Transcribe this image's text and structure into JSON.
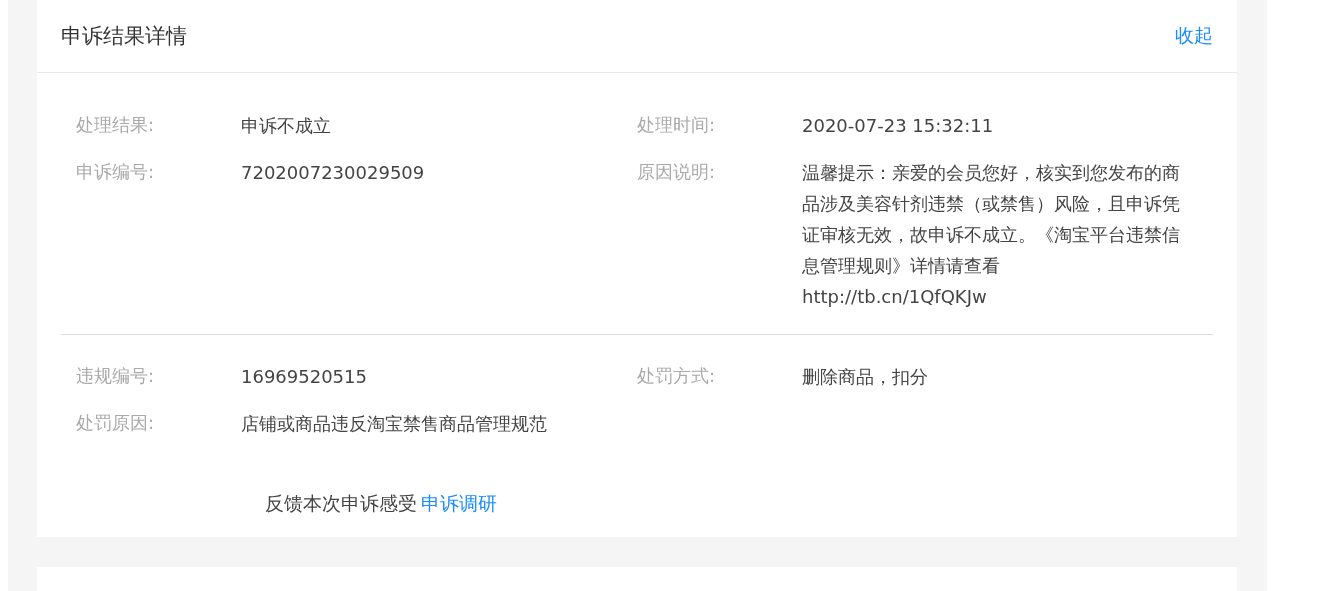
{
  "card": {
    "title": "申诉结果详情",
    "collapse_link": "收起"
  },
  "sections": [
    {
      "fields": [
        {
          "label": "处理结果:",
          "value": "申诉不成立"
        },
        {
          "label": "处理时间:",
          "value": "2020-07-23 15:32:11"
        },
        {
          "label": "申诉编号:",
          "value": "7202007230029509"
        },
        {
          "label": "原因说明:",
          "value": "温馨提示：亲爱的会员您好，核实到您发布的商品涉及美容针剂违禁（或禁售）风险，且申诉凭证审核无效，故申诉不成立。《淘宝平台违禁信息管理规则》详情请查看http://tb.cn/1QfQKJw"
        }
      ]
    },
    {
      "fields": [
        {
          "label": "违规编号:",
          "value": "16969520515"
        },
        {
          "label": "处罚方式:",
          "value": "删除商品，扣分"
        },
        {
          "label": "处罚原因:",
          "value": "店铺或商品违反淘宝禁售商品管理规范"
        }
      ]
    }
  ],
  "feedback": {
    "text": "反馈本次申诉感受",
    "link": "申诉调研"
  }
}
